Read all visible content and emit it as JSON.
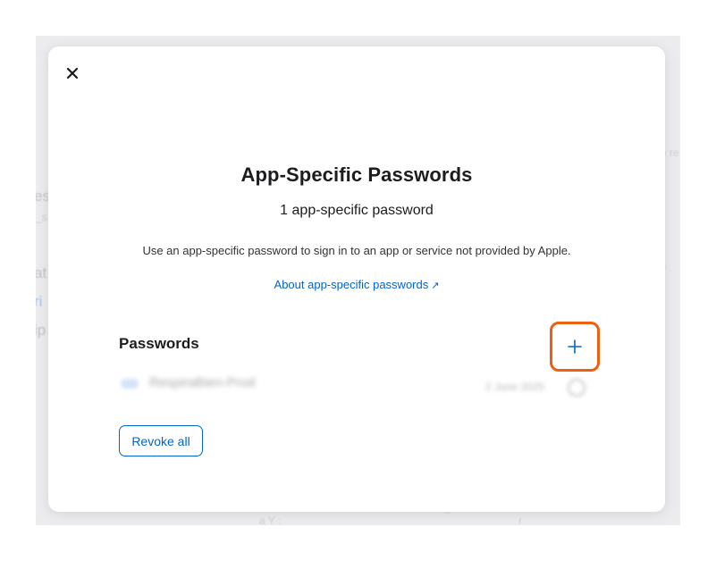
{
  "background": {
    "fragments": [
      "es",
      "_s",
      "at",
      "ri",
      "ip",
      "s",
      "e re",
      "a Y :",
      "@",
      "r"
    ]
  },
  "modal": {
    "close_icon": "close-icon",
    "title": "App-Specific Passwords",
    "subtitle": "1 app-specific password",
    "description": "Use an app-specific password to sign in to an app or service not provided by Apple.",
    "about_link": "About app-specific passwords",
    "about_link_arrow": "↗",
    "passwords_section": {
      "title": "Passwords",
      "add_icon": "plus-icon",
      "items": [
        {
          "name": "RespiraBien-Prod",
          "date": "2 June 2025",
          "delete_icon": "remove-icon"
        }
      ]
    },
    "revoke_all_label": "Revoke all"
  },
  "colors": {
    "accent": "#0066cc",
    "highlight": "#ee5f0e",
    "text": "#1d1d1f",
    "backdrop": "#ececee"
  }
}
